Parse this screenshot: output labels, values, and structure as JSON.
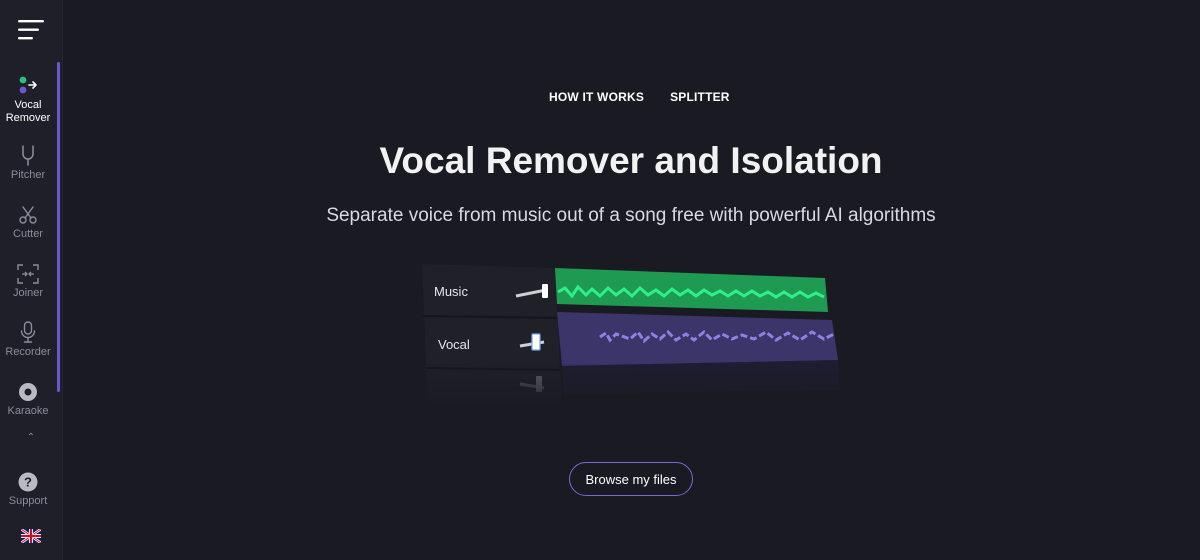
{
  "sidebar": {
    "items": [
      {
        "label": "Vocal Remover",
        "icon": "vocal-remover-icon",
        "active": true
      },
      {
        "label": "Pitcher",
        "icon": "tuning-fork-icon"
      },
      {
        "label": "Cutter",
        "icon": "scissors-icon"
      },
      {
        "label": "Joiner",
        "icon": "joiner-icon"
      },
      {
        "label": "Recorder",
        "icon": "microphone-icon"
      },
      {
        "label": "Karaoke",
        "icon": "disc-icon"
      }
    ],
    "support_label": "Support",
    "language": "en-GB"
  },
  "topnav": {
    "how_it_works": "HOW IT WORKS",
    "splitter": "SPLITTER"
  },
  "hero": {
    "title": "Vocal Remover and Isolation",
    "subtitle": "Separate voice from music out of a song free with powerful AI algorithms"
  },
  "tracks": {
    "music_label": "Music",
    "vocal_label": "Vocal"
  },
  "browse_label": "Browse my files",
  "colors": {
    "accent": "#6e56cf",
    "music_wave": "#1fe07a",
    "vocal_wave": "#8f80e6",
    "background": "#1a1a22"
  }
}
